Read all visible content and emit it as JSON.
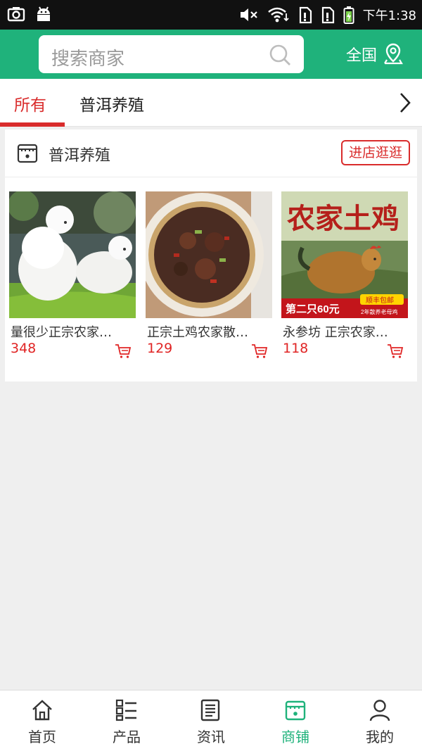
{
  "status_bar": {
    "time": "下午1:38",
    "icons": [
      "camera-icon",
      "android-icon",
      "mute-icon",
      "wifi-icon",
      "sim1-icon",
      "sim2-icon",
      "battery-icon"
    ]
  },
  "header": {
    "search_placeholder": "搜索商家",
    "region": "全国",
    "bg_color": "#1fb27b"
  },
  "tabs": {
    "items": [
      {
        "label": "所有",
        "active": true
      },
      {
        "label": "普洱养殖",
        "active": false
      }
    ],
    "accent_color": "#d92c2c"
  },
  "store": {
    "name": "普洱养殖",
    "visit_button": "进店逛逛",
    "products": [
      {
        "title": "量很少正宗农家…",
        "price": "348"
      },
      {
        "title": "正宗土鸡农家散…",
        "price": "129"
      },
      {
        "title": "永参坊 正宗农家…",
        "price": "118"
      }
    ],
    "poster": {
      "headline": "农家土鸡",
      "promo": "第二只60元",
      "badge": "顺丰包邮",
      "sub": "2年散养老母鸡"
    }
  },
  "bottom_nav": {
    "items": [
      {
        "label": "首页",
        "icon": "home-icon"
      },
      {
        "label": "产品",
        "icon": "product-list-icon"
      },
      {
        "label": "资讯",
        "icon": "news-icon"
      },
      {
        "label": "商铺",
        "icon": "store-icon",
        "active": true
      },
      {
        "label": "我的",
        "icon": "user-icon"
      }
    ]
  }
}
